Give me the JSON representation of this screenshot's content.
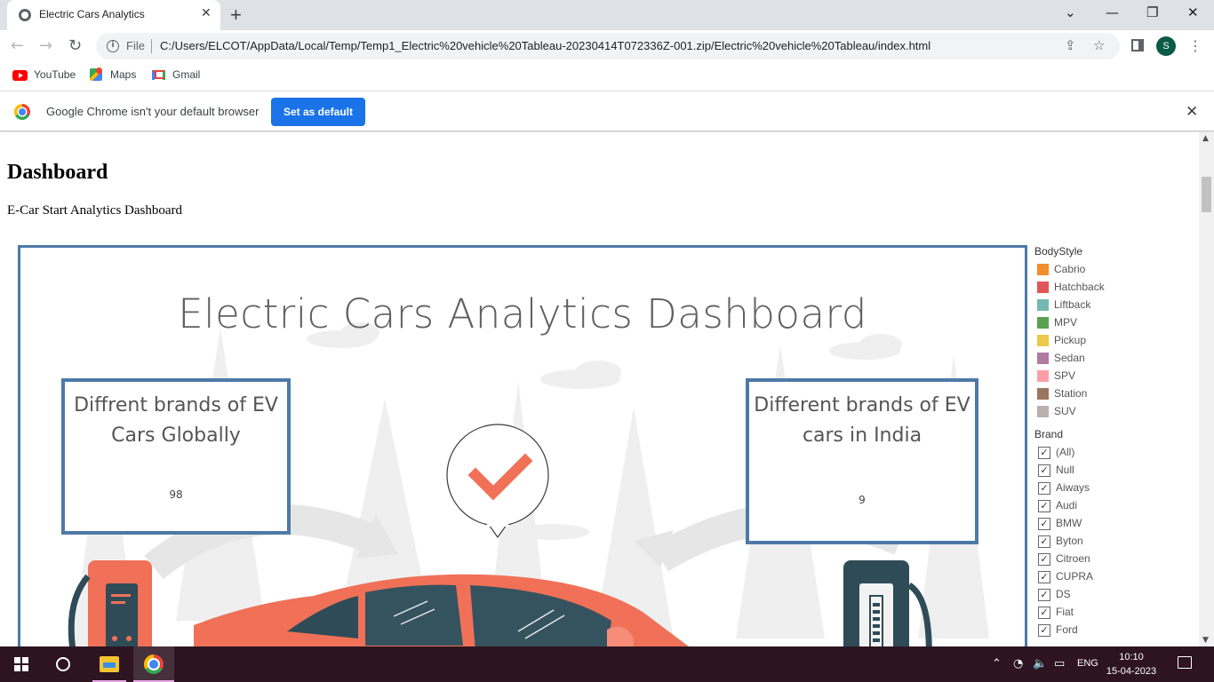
{
  "browser": {
    "tab_title": "Electric Cars Analytics",
    "tab_close": "✕",
    "new_tab": "+",
    "url_scheme": "File",
    "url": "C:/Users/ELCOT/AppData/Local/Temp/Temp1_Electric%20vehicle%20Tableau-20230414T072336Z-001.zip/Electric%20vehicle%20Tableau/index.html",
    "profile_initial": "S",
    "bookmarks": [
      "YouTube",
      "Maps",
      "Gmail"
    ],
    "infobar_message": "Google Chrome isn't your default browser",
    "infobar_button": "Set as default"
  },
  "page": {
    "heading": "Dashboard",
    "subheading": "E-Car Start Analytics Dashboard"
  },
  "dashboard": {
    "title": "Electric Cars Analytics Dashboard",
    "kpi_global": {
      "title": "Diffrent brands of EV Cars Globally",
      "value": "98"
    },
    "kpi_india": {
      "title": "Different brands of EV cars in India",
      "value": "9"
    }
  },
  "legend": {
    "title": "BodyStyle",
    "items": [
      {
        "label": "Cabrio",
        "color": "#f28e2b"
      },
      {
        "label": "Hatchback",
        "color": "#e15759"
      },
      {
        "label": "Liftback",
        "color": "#76b7b2"
      },
      {
        "label": "MPV",
        "color": "#59a14f"
      },
      {
        "label": "Pickup",
        "color": "#edc948"
      },
      {
        "label": "Sedan",
        "color": "#b07aa1"
      },
      {
        "label": "SPV",
        "color": "#ff9da7"
      },
      {
        "label": "Station",
        "color": "#9c755f"
      },
      {
        "label": "SUV",
        "color": "#bab0ac"
      }
    ]
  },
  "brand_filter": {
    "title": "Brand",
    "items": [
      "(All)",
      "Null",
      "Aiways",
      "Audi",
      "BMW",
      "Byton",
      "Citroen",
      "CUPRA",
      "DS",
      "Fiat",
      "Ford"
    ]
  },
  "taskbar": {
    "language": "ENG",
    "time": "10:10",
    "date": "15-04-2023"
  }
}
